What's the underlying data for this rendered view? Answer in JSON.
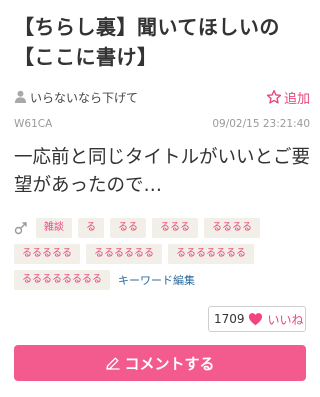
{
  "post": {
    "title_lines": [
      "【ちらし裏】聞いてほしいの",
      "【ここに書け】"
    ],
    "user_name": "いらないなら下げて",
    "add_favorite_label": "追加",
    "user_id": "W61CA",
    "timestamp": "09/02/15 23:21:40",
    "body": "一応前と同じタイトルがいいとご要望があったので…"
  },
  "tags": {
    "rows": [
      [
        "雑談",
        "る",
        "るる",
        "るるる",
        "るるるる"
      ],
      [
        "るるるるる",
        "るるるるるる",
        "るるるるるるる"
      ],
      [
        "るるるるるるるる"
      ]
    ],
    "keyword_edit_label": "キーワード編集"
  },
  "like": {
    "count": "1709",
    "label": "いいね"
  },
  "comment_button": {
    "label": "コメントする"
  },
  "colors": {
    "accent_pink": "#e8457a",
    "button_pink": "#f35b8f",
    "tag_bg": "#f2efe9",
    "link_blue": "#2d6a9f"
  },
  "icons": [
    "user-icon",
    "star-icon",
    "tag-icon",
    "heart-icon",
    "pen-icon"
  ]
}
